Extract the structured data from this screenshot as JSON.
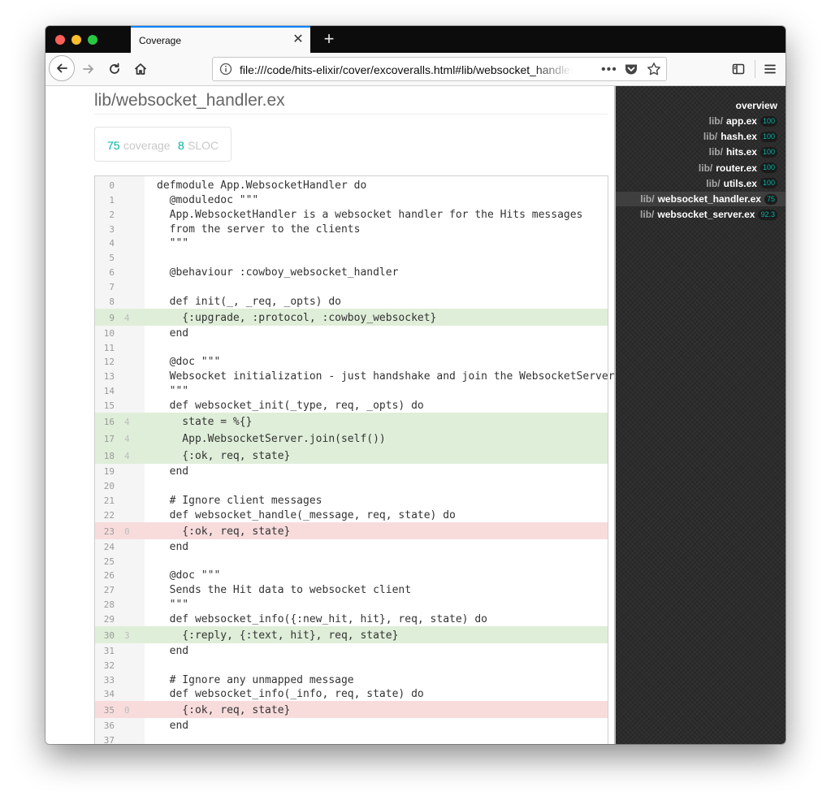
{
  "browser": {
    "tab_title": "Coverage",
    "url": "file:///code/hits-elixir/cover/excoveralls.html#lib/websocket_handler.ex",
    "url_more": "•••"
  },
  "page": {
    "title": "lib/websocket_handler.ex",
    "coverage_value": "75",
    "coverage_label": "coverage",
    "sloc_value": "8",
    "sloc_label": "SLOC"
  },
  "colors": {
    "covered_bg": "#dfeed9",
    "missed_bg": "#f8dcdc",
    "accent": "#00b3a1",
    "sidebar_bg": "#2c2c2c"
  },
  "code_lines": [
    {
      "n": "0",
      "hits": "",
      "code": "defmodule App.WebsocketHandler do",
      "status": "none"
    },
    {
      "n": "1",
      "hits": "",
      "code": "  @moduledoc \"\"\"",
      "status": "none"
    },
    {
      "n": "2",
      "hits": "",
      "code": "  App.WebsocketHandler is a websocket handler for the Hits messages",
      "status": "none"
    },
    {
      "n": "3",
      "hits": "",
      "code": "  from the server to the clients",
      "status": "none"
    },
    {
      "n": "4",
      "hits": "",
      "code": "  \"\"\"",
      "status": "none"
    },
    {
      "n": "5",
      "hits": "",
      "code": "",
      "status": "none"
    },
    {
      "n": "6",
      "hits": "",
      "code": "  @behaviour :cowboy_websocket_handler",
      "status": "none"
    },
    {
      "n": "7",
      "hits": "",
      "code": "",
      "status": "none"
    },
    {
      "n": "8",
      "hits": "",
      "code": "  def init(_, _req, _opts) do",
      "status": "none"
    },
    {
      "n": "9",
      "hits": "4",
      "code": "    {:upgrade, :protocol, :cowboy_websocket}",
      "status": "hit"
    },
    {
      "n": "10",
      "hits": "",
      "code": "  end",
      "status": "none"
    },
    {
      "n": "11",
      "hits": "",
      "code": "",
      "status": "none"
    },
    {
      "n": "12",
      "hits": "",
      "code": "  @doc \"\"\"",
      "status": "none"
    },
    {
      "n": "13",
      "hits": "",
      "code": "  Websocket initialization - just handshake and join the WebsocketServer",
      "status": "none"
    },
    {
      "n": "14",
      "hits": "",
      "code": "  \"\"\"",
      "status": "none"
    },
    {
      "n": "15",
      "hits": "",
      "code": "  def websocket_init(_type, req, _opts) do",
      "status": "none"
    },
    {
      "n": "16",
      "hits": "4",
      "code": "    state = %{}",
      "status": "hit"
    },
    {
      "n": "17",
      "hits": "4",
      "code": "    App.WebsocketServer.join(self())",
      "status": "hit"
    },
    {
      "n": "18",
      "hits": "4",
      "code": "    {:ok, req, state}",
      "status": "hit"
    },
    {
      "n": "19",
      "hits": "",
      "code": "  end",
      "status": "none"
    },
    {
      "n": "20",
      "hits": "",
      "code": "",
      "status": "none"
    },
    {
      "n": "21",
      "hits": "",
      "code": "  # Ignore client messages",
      "status": "none"
    },
    {
      "n": "22",
      "hits": "",
      "code": "  def websocket_handle(_message, req, state) do",
      "status": "none"
    },
    {
      "n": "23",
      "hits": "0",
      "code": "    {:ok, req, state}",
      "status": "miss"
    },
    {
      "n": "24",
      "hits": "",
      "code": "  end",
      "status": "none"
    },
    {
      "n": "25",
      "hits": "",
      "code": "",
      "status": "none"
    },
    {
      "n": "26",
      "hits": "",
      "code": "  @doc \"\"\"",
      "status": "none"
    },
    {
      "n": "27",
      "hits": "",
      "code": "  Sends the Hit data to websocket client",
      "status": "none"
    },
    {
      "n": "28",
      "hits": "",
      "code": "  \"\"\"",
      "status": "none"
    },
    {
      "n": "29",
      "hits": "",
      "code": "  def websocket_info({:new_hit, hit}, req, state) do",
      "status": "none"
    },
    {
      "n": "30",
      "hits": "3",
      "code": "    {:reply, {:text, hit}, req, state}",
      "status": "hit"
    },
    {
      "n": "31",
      "hits": "",
      "code": "  end",
      "status": "none"
    },
    {
      "n": "32",
      "hits": "",
      "code": "",
      "status": "none"
    },
    {
      "n": "33",
      "hits": "",
      "code": "  # Ignore any unmapped message",
      "status": "none"
    },
    {
      "n": "34",
      "hits": "",
      "code": "  def websocket_info(_info, req, state) do",
      "status": "none"
    },
    {
      "n": "35",
      "hits": "0",
      "code": "    {:ok, req, state}",
      "status": "miss"
    },
    {
      "n": "36",
      "hits": "",
      "code": "  end",
      "status": "none"
    },
    {
      "n": "37",
      "hits": "",
      "code": "",
      "status": "none"
    }
  ],
  "sidebar": {
    "overview_label": "overview",
    "files": [
      {
        "dir": "lib/",
        "file": "app.ex",
        "coverage": "100",
        "color": "#00b3a1",
        "active": false
      },
      {
        "dir": "lib/",
        "file": "hash.ex",
        "coverage": "100",
        "color": "#00b3a1",
        "active": false
      },
      {
        "dir": "lib/",
        "file": "hits.ex",
        "coverage": "100",
        "color": "#00b3a1",
        "active": false
      },
      {
        "dir": "lib/",
        "file": "router.ex",
        "coverage": "100",
        "color": "#00b3a1",
        "active": false
      },
      {
        "dir": "lib/",
        "file": "utils.ex",
        "coverage": "100",
        "color": "#00b3a1",
        "active": false
      },
      {
        "dir": "lib/",
        "file": "websocket_handler.ex",
        "coverage": "75",
        "color": "#00b3a1",
        "active": true
      },
      {
        "dir": "lib/",
        "file": "websocket_server.ex",
        "coverage": "92.3",
        "color": "#00b3a1",
        "active": false
      }
    ]
  }
}
